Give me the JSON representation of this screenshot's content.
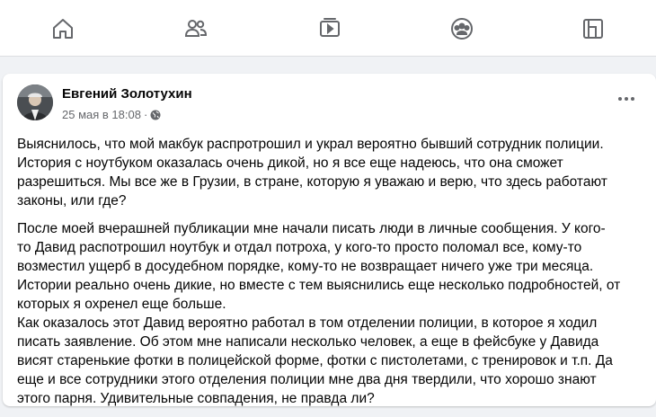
{
  "nav": {
    "items": [
      {
        "icon": "home-icon"
      },
      {
        "icon": "friends-icon"
      },
      {
        "icon": "watch-icon"
      },
      {
        "icon": "groups-icon"
      },
      {
        "icon": "gaming-icon"
      }
    ],
    "icon_color": "#65676b"
  },
  "post": {
    "author": "Евгений Золотухин",
    "date": "25 мая в 18:08",
    "separator": "·",
    "paragraph1": "Выяснилось, что мой макбук распротрошил и украл вероятно бывший сотрудник полиции.\nИстория с ноутбуком оказалась очень дикой, но я все еще надеюсь, что она сможет\nразрешиться. Мы все же в Грузии, в стране, которую я уважаю и верю, что здесь работают\nзаконы, или где?",
    "paragraph2": "После моей вчерашней публикации мне начали писать люди в личные сообщения. У кого-\nто Давид распотрошил ноутбук и отдал потроха, у кого-то просто поломал все, кому-то\nвозместил ущерб в досудебном порядке, кому-то не возвращает ничего уже три месяца.\nИстории реально очень дикие, но вместе с тем выяснились еще несколько подробностей, от\nкоторых я охренел еще больше.\nКак оказалось этот Давид вероятно работал в том отделении полиции, в которое я ходил\nписать заявление. Об этом мне написали несколько человек, а еще в фейсбуке у Давида\nвисят старенькие фотки в полицейской форме, фотки с пистолетами, с тренировок и т.п. Да\nеще и все сотрудники этого отделения полиции мне два дня твердили, что хорошо знают\nэтого парня. Удивительные совпадения, не правда ли?"
  }
}
